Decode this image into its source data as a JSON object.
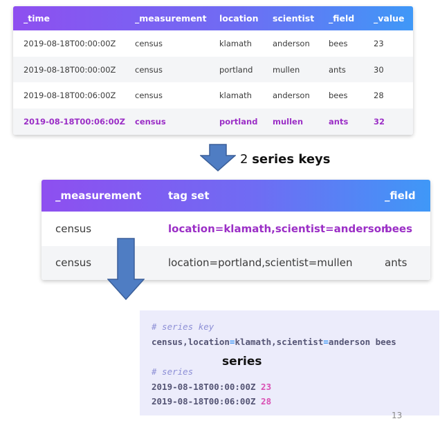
{
  "table1": {
    "headers": [
      "_time",
      "_measurement",
      "location",
      "scientist",
      "_field",
      "_value"
    ],
    "rows": [
      [
        "2019-08-18T00:00:00Z",
        "census",
        "klamath",
        "anderson",
        "bees",
        "23"
      ],
      [
        "2019-08-18T00:00:00Z",
        "census",
        "portland",
        "mullen",
        "ants",
        "30"
      ],
      [
        "2019-08-18T00:06:00Z",
        "census",
        "klamath",
        "anderson",
        "bees",
        "28"
      ],
      [
        "2019-08-18T00:06:00Z",
        "census",
        "portland",
        "mullen",
        "ants",
        "32"
      ]
    ]
  },
  "caption": {
    "count": "2",
    "label": "series keys"
  },
  "table2": {
    "headers": [
      "_measurement",
      "tag set",
      "_field"
    ],
    "rows": [
      [
        "census",
        "location=klamath,scientist=anderson",
        "bees"
      ],
      [
        "census",
        "location=portland,scientist=mullen",
        "ants"
      ]
    ]
  },
  "code": {
    "comment_key": "# series key",
    "key_measurement": "census,",
    "key_loc_name": "location",
    "key_loc_eq": "=",
    "key_loc_val": "klamath,",
    "key_sci_name": "scientist",
    "key_sci_eq": "=",
    "key_sci_val": "anderson bees",
    "comment_series": "# series",
    "series_label": "series",
    "points": [
      {
        "time": "2019-08-18T00:00:00Z",
        "value": "23"
      },
      {
        "time": "2019-08-18T00:06:00Z",
        "value": "28"
      }
    ]
  },
  "page_number": "13",
  "colors": {
    "gradient_start": "#8e4ff0",
    "gradient_end": "#3f98f7",
    "highlight": "#9b2fc6",
    "arrow_fill": "#4f7dc3",
    "code_bg": "#ececfb"
  }
}
